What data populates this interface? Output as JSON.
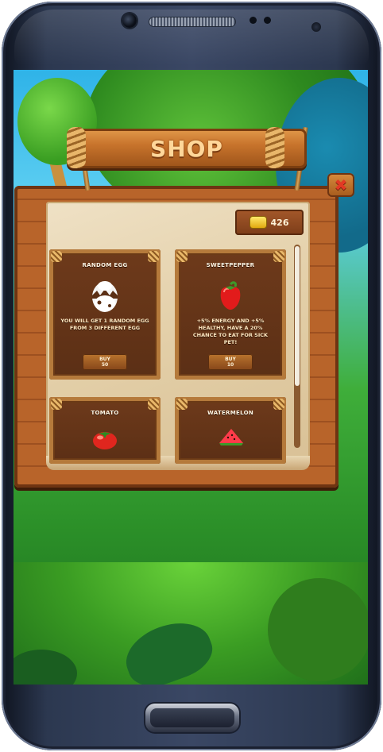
{
  "shop": {
    "title": "SHOP",
    "coins": "426",
    "close_label": "✖"
  },
  "items": [
    {
      "name": "RANDOM EGG",
      "icon": "egg-icon",
      "description": "YOU WILL GET 1 RANDOM EGG FROM 3 DIFFERENT EGG",
      "buy_label": "BUY",
      "price": "50"
    },
    {
      "name": "SWEETPEPPER",
      "icon": "pepper-icon",
      "description": "+5% ENERGY AND +5% HEALTHY, HAVE A 20% CHANCE TO EAT FOR SICK PET!",
      "buy_label": "BUY",
      "price": "10"
    },
    {
      "name": "TOMATO",
      "icon": "tomato-icon"
    },
    {
      "name": "WATERMELON",
      "icon": "watermelon-icon"
    }
  ],
  "colors": {
    "wood": "#b8642a",
    "parchment": "#e3cfa8",
    "title": "#ffd79a",
    "close": "#e23a24"
  }
}
